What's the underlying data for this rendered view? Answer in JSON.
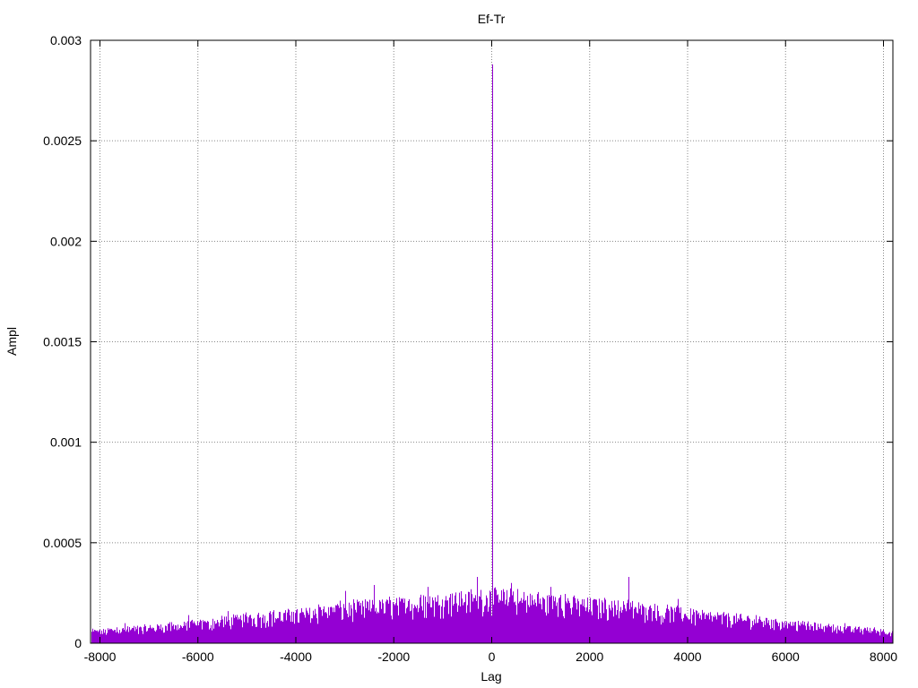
{
  "chart_data": {
    "type": "bar",
    "title": "Ef-Tr",
    "xlabel": "Lag",
    "ylabel": "Ampl",
    "xlim": [
      -8192,
      8192
    ],
    "ylim": [
      0,
      0.003
    ],
    "grid": true,
    "color": "#9400d3",
    "x_ticks": [
      -8000,
      -6000,
      -4000,
      -2000,
      0,
      2000,
      4000,
      6000,
      8000
    ],
    "x_tick_labels": [
      "-8000",
      "-6000",
      "-4000",
      "-2000",
      "0",
      "2000",
      "4000",
      "6000",
      "8000"
    ],
    "y_ticks": [
      0,
      0.0005,
      0.001,
      0.0015,
      0.002,
      0.0025,
      0.003
    ],
    "y_tick_labels": [
      "0",
      "0.0005",
      "0.001",
      "0.0015",
      "0.002",
      "0.0025",
      "0.003"
    ],
    "peak": {
      "x": 0,
      "y": 0.00288
    },
    "envelope": {
      "x": [
        -8192,
        -7000,
        -6000,
        -5000,
        -4000,
        -3000,
        -2000,
        -1000,
        0,
        1000,
        2000,
        3000,
        4000,
        5000,
        6000,
        7000,
        8192
      ],
      "y": [
        6e-05,
        8e-05,
        0.0001,
        0.00013,
        0.00015,
        0.00018,
        0.0002,
        0.00022,
        0.00024,
        0.00022,
        0.0002,
        0.00018,
        0.00015,
        0.00013,
        0.0001,
        8e-05,
        6e-05
      ]
    },
    "notable_spikes": [
      {
        "x": -7500,
        "y": 0.0001
      },
      {
        "x": -6200,
        "y": 0.00014
      },
      {
        "x": -5400,
        "y": 0.00016
      },
      {
        "x": -3000,
        "y": 0.00026
      },
      {
        "x": -2400,
        "y": 0.00029
      },
      {
        "x": -1300,
        "y": 0.00028
      },
      {
        "x": -300,
        "y": 0.00033
      },
      {
        "x": 400,
        "y": 0.0003
      },
      {
        "x": 1200,
        "y": 0.00028
      },
      {
        "x": 2800,
        "y": 0.00033
      },
      {
        "x": 3800,
        "y": 0.00022
      },
      {
        "x": 5400,
        "y": 0.00014
      },
      {
        "x": 7200,
        "y": 0.0001
      }
    ]
  }
}
